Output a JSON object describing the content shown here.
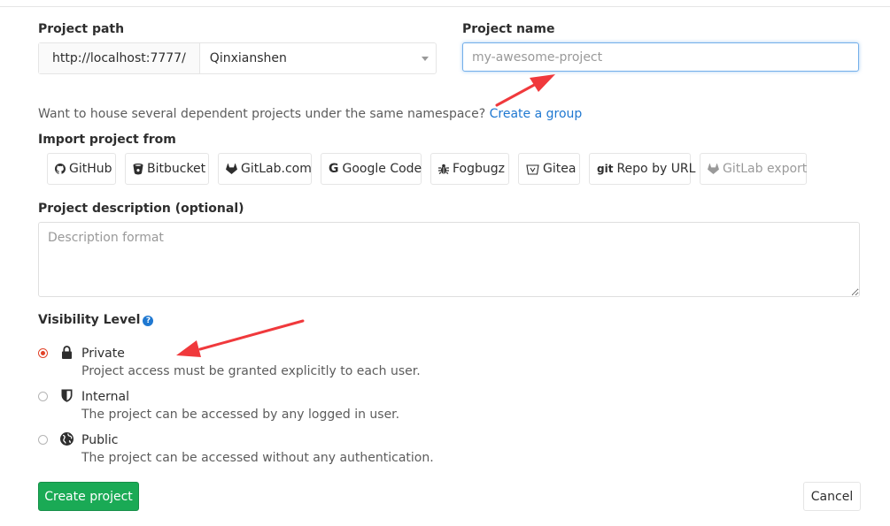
{
  "project_path": {
    "label": "Project path",
    "prefix": "http://localhost:7777/",
    "namespace": "Qinxianshen"
  },
  "project_name": {
    "label": "Project name",
    "placeholder": "my-awesome-project",
    "value": ""
  },
  "group_hint": {
    "text": "Want to house several dependent projects under the same namespace?",
    "link": "Create a group"
  },
  "import": {
    "label": "Import project from",
    "sources": [
      {
        "label": "GitHub",
        "icon": "github-icon",
        "enabled": true
      },
      {
        "label": "Bitbucket",
        "icon": "bitbucket-icon",
        "enabled": true
      },
      {
        "label": "GitLab.com",
        "icon": "gitlab-icon",
        "enabled": true
      },
      {
        "label": "Google Code",
        "icon": "google-icon",
        "enabled": true
      },
      {
        "label": "Fogbugz",
        "icon": "bug-icon",
        "enabled": true
      },
      {
        "label": "Gitea",
        "icon": "gitea-icon",
        "enabled": true
      },
      {
        "label": "Repo by URL",
        "icon": "git-icon",
        "icon_text": "git",
        "enabled": true
      },
      {
        "label": "GitLab export",
        "icon": "gitlab-icon",
        "enabled": false
      }
    ]
  },
  "description": {
    "label": "Project description (optional)",
    "placeholder": "Description format"
  },
  "visibility": {
    "label": "Visibility Level",
    "options": [
      {
        "title": "Private",
        "description": "Project access must be granted explicitly to each user.",
        "icon": "lock-icon",
        "selected": true
      },
      {
        "title": "Internal",
        "description": "The project can be accessed by any logged in user.",
        "icon": "shield-icon",
        "selected": false
      },
      {
        "title": "Public",
        "description": "The project can be accessed without any authentication.",
        "icon": "globe-icon",
        "selected": false
      }
    ]
  },
  "actions": {
    "create_label": "Create project",
    "cancel_label": "Cancel"
  },
  "colors": {
    "accent_link": "#1f78d1",
    "create_button": "#1aaa55",
    "annotation_arrow": "#f0393c",
    "selected_radio": "#e24329"
  }
}
